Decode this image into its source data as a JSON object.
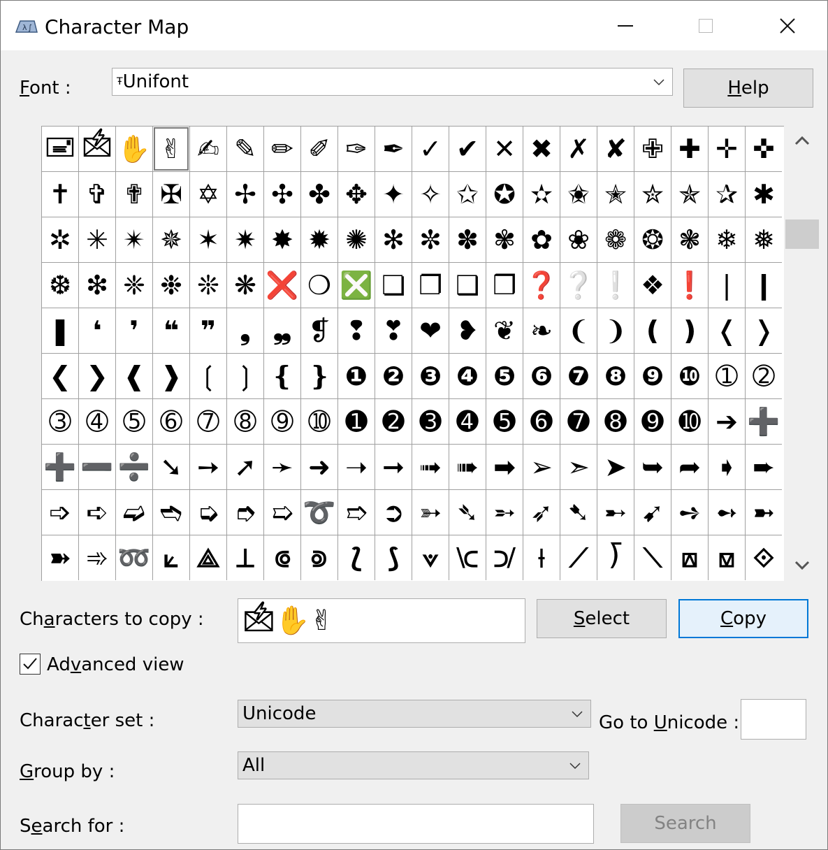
{
  "window": {
    "title": "Character Map"
  },
  "font": {
    "label_pre": "",
    "label_u": "F",
    "label_post": "ont :",
    "value": "Unifont",
    "font_icon": "Ŧ"
  },
  "help_button": {
    "label_u": "H",
    "label_post": "elp"
  },
  "grid": {
    "rows": [
      [
        "🖃",
        "🖄",
        "✋",
        "✌",
        "✍",
        "✎",
        "✏",
        "✐",
        "✑",
        "✒",
        "✓",
        "✔",
        "✕",
        "✖",
        "✗",
        "✘",
        "✙",
        "✚",
        "✛",
        "✜"
      ],
      [
        "✝",
        "✞",
        "✟",
        "✠",
        "✡",
        "✢",
        "✣",
        "✤",
        "✥",
        "✦",
        "✧",
        "✩",
        "✪",
        "✫",
        "✬",
        "✭",
        "✮",
        "✯",
        "✰",
        "✱"
      ],
      [
        "✲",
        "✳",
        "✴",
        "✵",
        "✶",
        "✷",
        "✸",
        "✹",
        "✺",
        "✻",
        "✼",
        "✽",
        "✾",
        "✿",
        "❀",
        "❁",
        "❂",
        "❃",
        "❄",
        "❅"
      ],
      [
        "❆",
        "❇",
        "❈",
        "❉",
        "❊",
        "❋",
        "❌",
        "❍",
        "❎",
        "❏",
        "❐",
        "❑",
        "❒",
        "❓",
        "❔",
        "❕",
        "❖",
        "❗",
        "❘",
        "❙"
      ],
      [
        "❚",
        "❛",
        "❜",
        "❝",
        "❞",
        "❟",
        "❠",
        "❡",
        "❢",
        "❣",
        "❤",
        "❥",
        "❦",
        "❧",
        "❨",
        "❩",
        "❪",
        "❫",
        "❬",
        "❭"
      ],
      [
        "❮",
        "❯",
        "❰",
        "❱",
        "❲",
        "❳",
        "❴",
        "❵",
        "❶",
        "❷",
        "❸",
        "❹",
        "❺",
        "❻",
        "❼",
        "❽",
        "❾",
        "❿",
        "➀",
        "➁"
      ],
      [
        "➂",
        "➃",
        "➄",
        "➅",
        "➆",
        "➇",
        "➈",
        "➉",
        "➊",
        "➋",
        "➌",
        "➍",
        "➎",
        "➏",
        "➐",
        "➑",
        "➒",
        "➓",
        "➔",
        "➕"
      ],
      [
        "➕",
        "➖",
        "➗",
        "➘",
        "➙",
        "➚",
        "➛",
        "➜",
        "➝",
        "➞",
        "➟",
        "➠",
        "➡",
        "➢",
        "➣",
        "➤",
        "➥",
        "➦",
        "➧",
        "➨"
      ],
      [
        "➩",
        "➪",
        "➫",
        "➬",
        "➭",
        "➮",
        "➯",
        "➰",
        "➱",
        "➲",
        "➳",
        "➴",
        "➵",
        "➶",
        "➷",
        "➸",
        "➹",
        "➺",
        "➻",
        "➼"
      ],
      [
        "➽",
        "➾",
        "➿",
        "⟀",
        "⟁",
        "⟂",
        "⟃",
        "⟄",
        "⟅",
        "⟆",
        "⟇",
        "⟈",
        "⟉",
        "⟊",
        "⟋",
        "⟌",
        "⟍",
        "⟎",
        "⟏",
        "⟐"
      ]
    ]
  },
  "characters_to_copy": {
    "label_pre": "Ch",
    "label_u": "a",
    "label_post": "racters to copy :",
    "value": "🖄✋✌"
  },
  "select_button": {
    "label_u": "S",
    "label_post": "elect"
  },
  "copy_button": {
    "label_u": "C",
    "label_post": "opy"
  },
  "advanced_view": {
    "label_pre": "Ad",
    "label_u": "v",
    "label_post": "anced view",
    "checked": true
  },
  "character_set": {
    "label_pre": "Charac",
    "label_u": "t",
    "label_post": "er set :",
    "value": "Unicode"
  },
  "go_to_unicode": {
    "label_pre": "Go to ",
    "label_u": "U",
    "label_post": "nicode :",
    "value": ""
  },
  "group_by": {
    "label_pre": "",
    "label_u": "G",
    "label_post": "roup by :",
    "value": "All"
  },
  "search_for": {
    "label_pre": "S",
    "label_u": "e",
    "label_post": "arch for :",
    "value": ""
  },
  "search_button": {
    "label": "Search",
    "disabled": true
  },
  "colors": {
    "window_bg": "#f0f0f0",
    "focus_border": "#0078d7",
    "focus_bg": "#e5f1fb"
  }
}
